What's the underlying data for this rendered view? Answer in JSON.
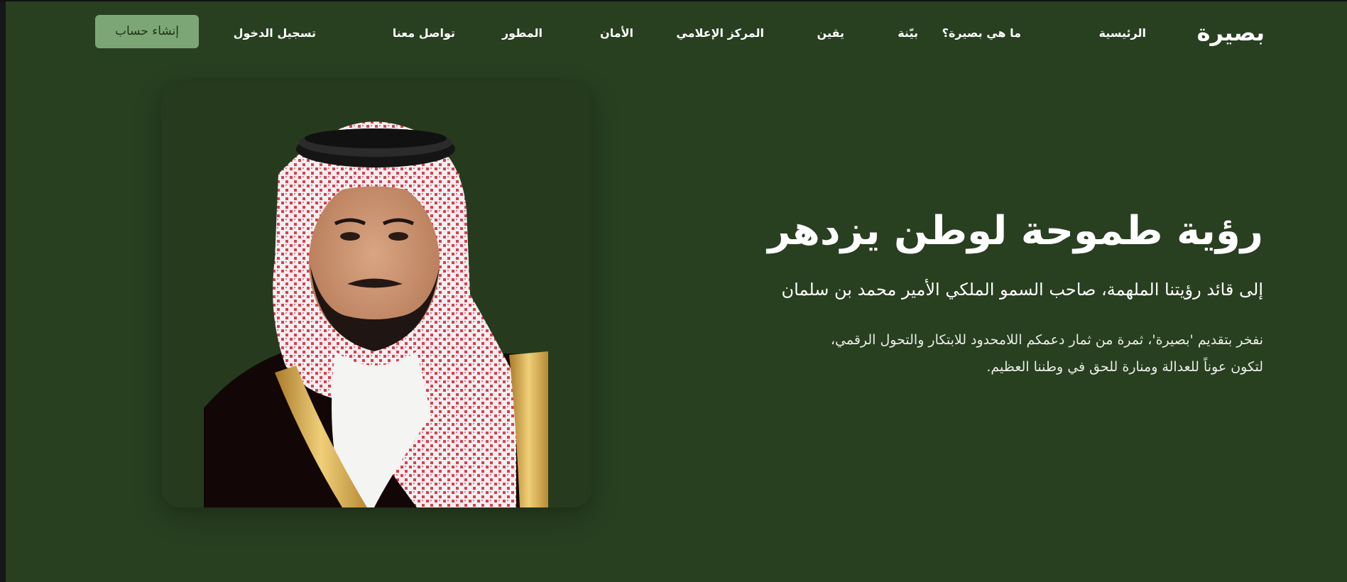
{
  "header": {
    "brand": "بصيرة",
    "nav": [
      {
        "id": "home",
        "label": "الرئيسية"
      },
      {
        "id": "what-is",
        "label": "ما هي بصيرة؟"
      },
      {
        "id": "bayyina",
        "label": "بيّنة"
      },
      {
        "id": "yaqeen",
        "label": "يقين"
      },
      {
        "id": "media-center",
        "label": "المركز الإعلامي"
      },
      {
        "id": "security",
        "label": "الأمان"
      },
      {
        "id": "developer",
        "label": "المطور"
      },
      {
        "id": "contact",
        "label": "تواصل معنا"
      },
      {
        "id": "login",
        "label": "تسجيل الدخول"
      }
    ],
    "signup_label": "إنشاء حساب"
  },
  "hero": {
    "title": "رؤية طموحة لوطن يزدهر",
    "subtitle": "إلى قائد رؤيتنا الملهمة، صاحب السمو الملكي الأمير محمد بن سلمان",
    "body_line1": "نفخر بتقديم 'بصيرة'، ثمرة من ثمار دعمكم اللامحدود للابتكار والتحول الرقمي،",
    "body_line2": "لتكون عوناً للعدالة ومنارة للحق في وطننا العظيم."
  },
  "colors": {
    "background": "#283f20",
    "accent_button": "#7da676",
    "text": "#ffffff"
  }
}
